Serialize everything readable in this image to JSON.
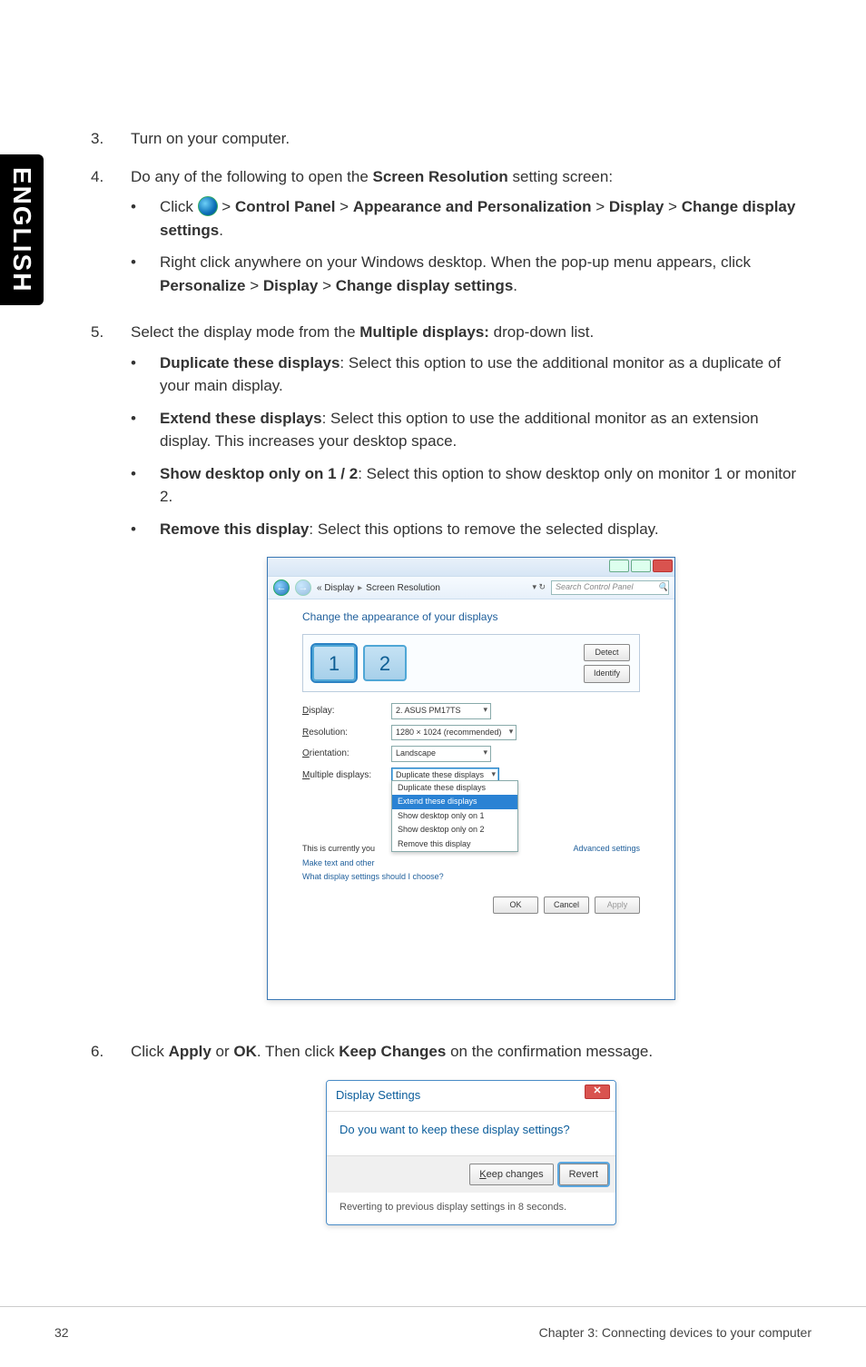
{
  "side_label": "ENGLISH",
  "steps": {
    "s3": {
      "num": "3.",
      "text": "Turn on your computer."
    },
    "s4": {
      "num": "4.",
      "intro_a": "Do any of the following to open the ",
      "intro_b": "Screen Resolution",
      "intro_c": " setting screen:",
      "b1_a": "Click ",
      "b1_b": " > ",
      "b1_cp": "Control Panel",
      "b1_c": " > ",
      "b1_ap": "Appearance and Personalization",
      "b1_d": " > ",
      "b1_dp": "Display",
      "b1_e": " > ",
      "b1_ch": "Change display settings",
      "b1_f": ".",
      "b2_a": "Right click anywhere on your Windows desktop. When the pop-up menu appears, click ",
      "b2_p": "Personalize",
      "b2_b": " > ",
      "b2_d": "Display",
      "b2_c": " > ",
      "b2_ch": "Change display settings",
      "b2_e": "."
    },
    "s5": {
      "num": "5.",
      "intro_a": "Select the display mode from the ",
      "intro_b": "Multiple displays:",
      "intro_c": " drop-down list.",
      "d1_h": "Duplicate these displays",
      "d1_t": ": Select this option to use the additional monitor as a duplicate of your main display.",
      "d2_h": "Extend these displays",
      "d2_t": ": Select this option to use the additional monitor as an extension display. This increases your desktop space.",
      "d3_h": "Show desktop only on 1 / 2",
      "d3_t": ": Select this option to show desktop only on monitor 1 or monitor 2.",
      "d4_h": "Remove this display",
      "d4_t": ": Select this options to remove the selected display."
    },
    "s6": {
      "num": "6.",
      "a": "Click ",
      "apply": "Apply",
      "b": " or ",
      "ok": "OK",
      "c": ". Then click ",
      "keep": "Keep Changes",
      "d": " on the confirmation message."
    }
  },
  "sr": {
    "crumb_a": "«  Display",
    "crumb_b": "Screen Resolution",
    "search_ph": "Search Control Panel",
    "heading": "Change the appearance of your displays",
    "mon1": "1",
    "mon2": "2",
    "detect": "Detect",
    "identify": "Identify",
    "row_display_l": "Display:",
    "row_display_v": "2. ASUS PM17TS",
    "row_res_l": "Resolution:",
    "row_res_v": "1280 × 1024 (recommended)",
    "row_orient_l": "Orientation:",
    "row_orient_v": "Landscape",
    "row_multi_l": "Multiple displays:",
    "row_multi_v": "Duplicate these displays",
    "dd_opts": [
      "Duplicate these displays",
      "Extend these displays",
      "Show desktop only on 1",
      "Show desktop only on 2",
      "Remove this display"
    ],
    "note_a": "This is currently you",
    "link_make": "Make text and other",
    "link_what": "What display settings should I choose?",
    "adv": "Advanced settings",
    "ok": "OK",
    "cancel": "Cancel",
    "apply": "Apply"
  },
  "ds": {
    "title": "Display Settings",
    "question": "Do you want to keep these display settings?",
    "keep": "Keep changes",
    "revert": "Revert",
    "footer": "Reverting to previous display settings in 8 seconds."
  },
  "footer": {
    "page": "32",
    "chapter": "Chapter 3: Connecting devices to your computer"
  }
}
